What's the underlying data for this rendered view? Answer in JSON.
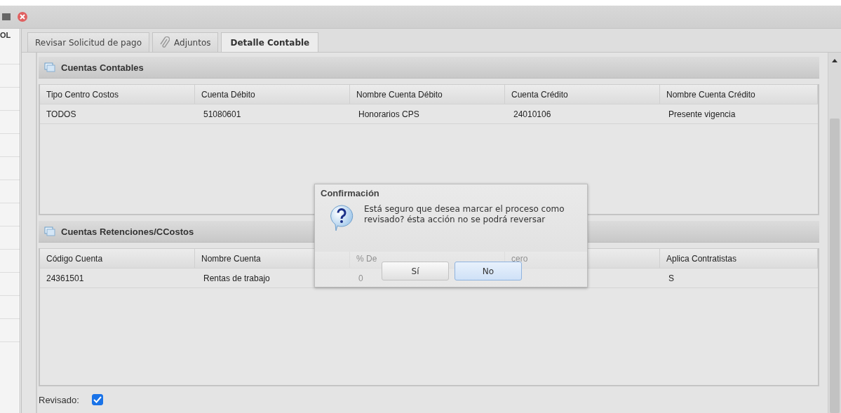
{
  "side_panel": {
    "text": "OL"
  },
  "tabs": [
    {
      "label": "Revisar Solicitud de pago",
      "selected": false,
      "has_icon": false
    },
    {
      "label": "Adjuntos",
      "selected": false,
      "has_icon": true
    },
    {
      "label": "Detalle Contable",
      "selected": true,
      "has_icon": false
    }
  ],
  "sections": [
    {
      "title": "Cuentas Contables",
      "columns": [
        "Tipo Centro Costos",
        "Cuenta Débito",
        "Nombre Cuenta Débito",
        "Cuenta Crédito",
        "Nombre Cuenta Crédito"
      ],
      "rows": [
        [
          "TODOS",
          "51080601",
          "Honorarios CPS",
          "24010106",
          "Presente vigencia"
        ]
      ]
    },
    {
      "title": "Cuentas Retenciones/CCostos",
      "columns": [
        "Código Cuenta",
        "Nombre Cuenta",
        "% De",
        "cero",
        "Aplica Contratistas"
      ],
      "rows": [
        [
          "24361501",
          "Rentas de trabajo",
          "0",
          null,
          "S"
        ]
      ]
    }
  ],
  "revisado": {
    "label": "Revisado:",
    "checked": true
  },
  "dialog": {
    "title": "Confirmación",
    "message": "Está seguro que desea marcar el proceso como revisado? ésta acción no se podrá reversar",
    "buttons": [
      {
        "label": "Sí",
        "focused": false
      },
      {
        "label": "No",
        "focused": true
      }
    ]
  }
}
